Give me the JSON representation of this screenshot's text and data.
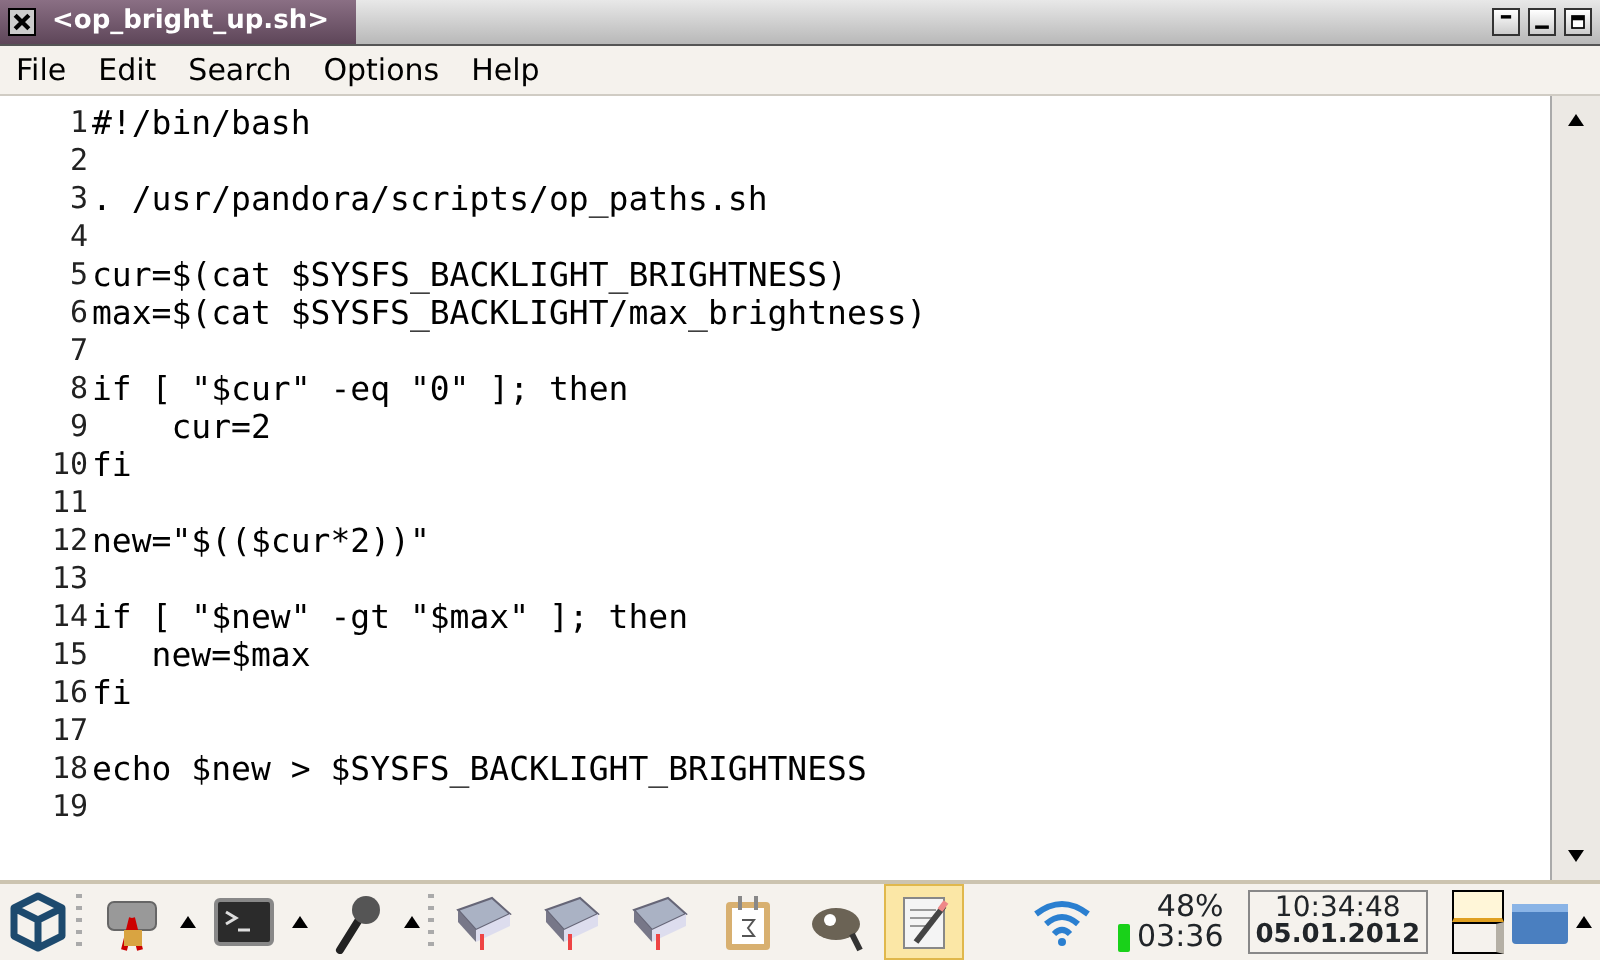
{
  "window": {
    "title": "<op_bright_up.sh>"
  },
  "menu": [
    "File",
    "Edit",
    "Search",
    "Options",
    "Help"
  ],
  "editor": {
    "lines": [
      {
        "number": "1",
        "text": "#!/bin/bash"
      },
      {
        "number": "2"
      },
      {
        "number": "3",
        "text": ". /usr/pandora/scripts/op_paths.sh"
      },
      {
        "number": "4"
      },
      {
        "number": "5",
        "text": "cur=$(cat $SYSFS_BACKLIGHT_BRIGHTNESS)"
      },
      {
        "number": "6",
        "text": "max=$(cat $SYSFS_BACKLIGHT/max_brightness)"
      },
      {
        "number": "7"
      },
      {
        "number": "8",
        "text": "if [ \"$cur\" -eq \"0\" ]; then"
      },
      {
        "number": "9",
        "text": "    cur=2"
      },
      {
        "number": "10",
        "text": "fi"
      },
      {
        "number": "11"
      },
      {
        "number": "12",
        "text": "new=\"$(($cur*2))\""
      },
      {
        "number": "13"
      },
      {
        "number": "14",
        "text": "if [ \"$new\" -gt \"$max\" ]; then"
      },
      {
        "number": "15",
        "text": "   new=$max"
      },
      {
        "number": "16",
        "text": "fi"
      },
      {
        "number": "17"
      },
      {
        "number": "18",
        "text": "echo $new > $SYSFS_BACKLIGHT_BRIGHTNESS"
      },
      {
        "number": "19"
      }
    ]
  },
  "taskbar": {
    "launchers": [
      {
        "kind": "package"
      },
      {
        "kind": "terminal"
      },
      {
        "kind": "microphone"
      }
    ],
    "tasks": [
      {
        "kind": "book",
        "selected": false
      },
      {
        "kind": "book",
        "selected": false
      },
      {
        "kind": "book",
        "selected": false
      },
      {
        "kind": "calendar",
        "selected": false
      },
      {
        "kind": "gimp",
        "selected": false
      },
      {
        "kind": "editor",
        "selected": true
      }
    ],
    "battery": {
      "percent": "48%",
      "time": "03:36"
    },
    "clock": {
      "time": "10:34:48",
      "date": "05.01.2012"
    },
    "workspaces": [
      {
        "selected": true
      },
      {
        "selected": false
      }
    ]
  }
}
